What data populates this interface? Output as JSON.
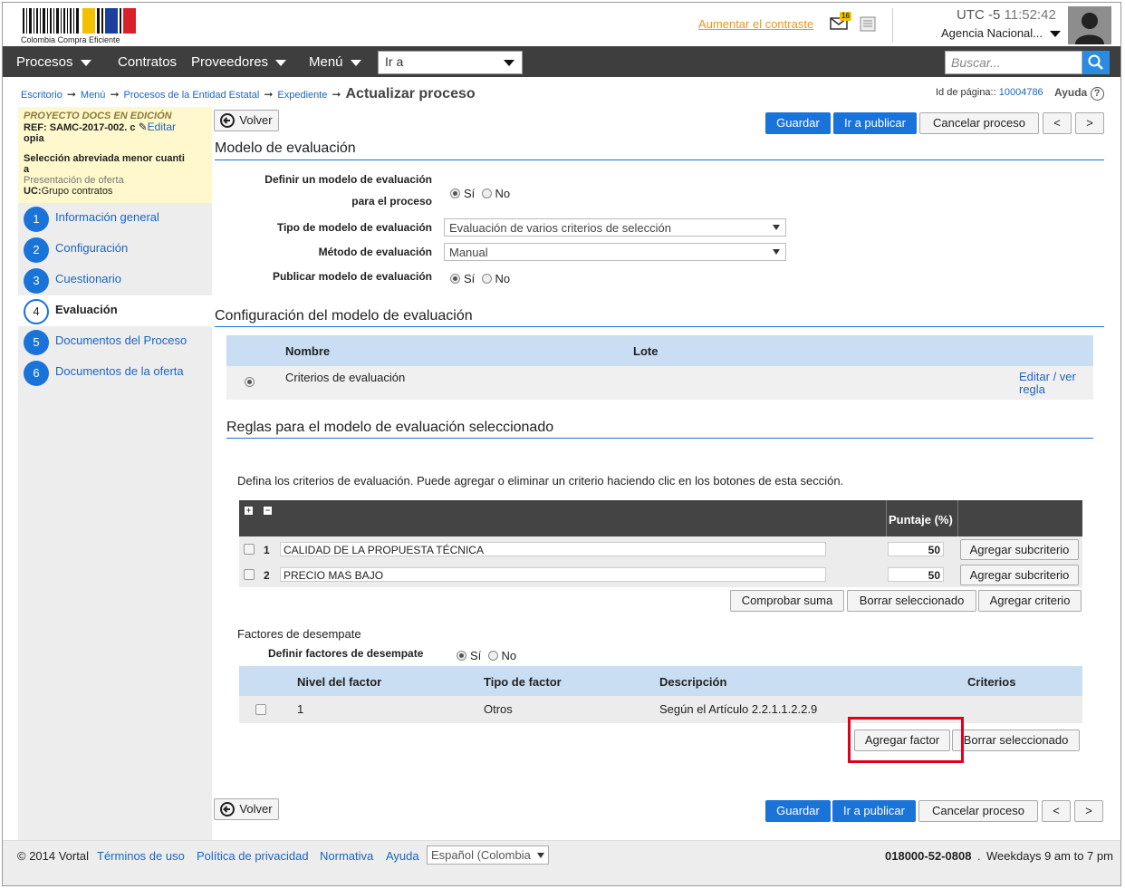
{
  "header": {
    "logo_text": "Colombia Compra Eficiente",
    "contrast_link": "Aumentar el contraste",
    "mail_badge": "16",
    "utc_label": "UTC -5",
    "time": "11:52:42",
    "agency": "Agencia Nacional..."
  },
  "nav": {
    "items": [
      "Procesos",
      "Contratos",
      "Proveedores",
      "Menú"
    ],
    "goto": "Ir a",
    "search_placeholder": "Buscar..."
  },
  "breadcrumb": {
    "items": [
      "Escritorio",
      "Menú",
      "Procesos de la Entidad Estatal",
      "Expediente"
    ],
    "title": "Actualizar proceso",
    "page_id_label": "Id de página::",
    "page_id": "10004786",
    "help": "Ayuda"
  },
  "project": {
    "status": "PROYECTO DOCS EN EDICIÓN",
    "ref_label": "REF:",
    "ref_value": "SAMC-2017-002. c",
    "edit": "Editar",
    "ref_tail": "opia",
    "type_line1": "Selección abreviada menor cuanti",
    "type_line2": "a",
    "phase": "Presentación de oferta",
    "uc_label": "UC:",
    "uc_value": "Grupo contratos"
  },
  "steps": [
    {
      "num": "1",
      "label": "Información general"
    },
    {
      "num": "2",
      "label": "Configuración"
    },
    {
      "num": "3",
      "label": "Cuestionario"
    },
    {
      "num": "4",
      "label": "Evaluación"
    },
    {
      "num": "5",
      "label": "Documentos del Proceso"
    },
    {
      "num": "6",
      "label": "Documentos de la oferta"
    }
  ],
  "toolbar": {
    "back": "Volver",
    "save": "Guardar",
    "publish": "Ir a publicar",
    "cancel": "Cancelar proceso",
    "prev": "<",
    "next": ">"
  },
  "model": {
    "section_title": "Modelo de evaluación",
    "define_label_1": "Definir un modelo de evaluación",
    "define_label_2": "para el proceso",
    "yes": "Sí",
    "no": "No",
    "type_label": "Tipo de modelo de evaluación",
    "type_value": "Evaluación de varios criterios de selección",
    "method_label": "Método de evaluación",
    "method_value": "Manual",
    "publish_label": "Publicar modelo de evaluación"
  },
  "config": {
    "section_title": "Configuración del modelo de evaluación",
    "col_name": "Nombre",
    "col_lot": "Lote",
    "row_name": "Criterios de evaluación",
    "edit_link_1": "Editar / ver",
    "edit_link_2": "regla"
  },
  "rules": {
    "section_title": "Reglas para el modelo de evaluación seleccionado",
    "instructions": "Defina los criterios de evaluación. Puede agregar o eliminar un criterio haciendo clic en los botones de esta sección.",
    "score_header": "Puntaje (%)",
    "criteria": [
      {
        "num": "1",
        "name": "CALIDAD DE LA PROPUESTA TÉCNICA",
        "score": "50",
        "action": "Agregar subcriterio"
      },
      {
        "num": "2",
        "name": "PRECIO MAS BAJO",
        "score": "50",
        "action": "Agregar subcriterio"
      }
    ],
    "check_sum": "Comprobar suma",
    "delete_selected": "Borrar seleccionado",
    "add_criterion": "Agregar criterio"
  },
  "tiebreak": {
    "title": "Factores de desempate",
    "define_label": "Definir factores de desempate",
    "yes": "Sí",
    "no": "No",
    "col_level": "Nivel del factor",
    "col_type": "Tipo de factor",
    "col_desc": "Descripción",
    "col_criteria": "Criterios",
    "row_level": "1",
    "row_type": "Otros",
    "row_desc": "Según el Artículo 2.2.1.1.2.2.9",
    "add_factor": "Agregar factor",
    "delete_selected": "Borrar seleccionado"
  },
  "footer": {
    "copyright": "© 2014 Vortal",
    "links": [
      "Términos de uso",
      "Política de privacidad",
      "Normativa",
      "Ayuda"
    ],
    "language": "Español (Colombia",
    "phone": "018000-52-0808",
    "hours": "Weekdays 9 am to 7 pm"
  },
  "colors": {
    "accent": "#1a73d9",
    "nav_bg": "#3e3e3e",
    "highlight": "#e0001a",
    "project_bg": "#fff8cc"
  }
}
